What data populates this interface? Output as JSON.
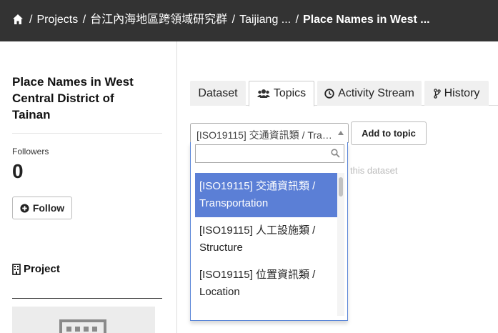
{
  "breadcrumb": {
    "home_icon": "home-icon",
    "items": [
      "Projects",
      "台江內海地區跨領域研究群",
      "Taijiang ..."
    ],
    "current": "Place Names in West ...",
    "separator": "/"
  },
  "sidebar": {
    "title": "Place Names in West Central District of Tainan",
    "followers_label": "Followers",
    "followers_count": "0",
    "follow_button": "Follow",
    "project_label": "Project"
  },
  "tabs": [
    {
      "label": "Dataset",
      "icon": ""
    },
    {
      "label": "Topics",
      "icon": "users-icon"
    },
    {
      "label": "Activity Stream",
      "icon": "clock-icon"
    },
    {
      "label": "History",
      "icon": "branch-icon"
    }
  ],
  "topic_select": {
    "value": "[ISO19115] 交通資訊類 / Transportation",
    "search_value": "",
    "options": [
      "[ISO19115] 交通資訊類 / Transportation",
      "[ISO19115] 人工設施類 / Structure",
      "[ISO19115] 位置資訊類 / Location"
    ]
  },
  "add_topic_button": "Add to topic",
  "hint_text": "this dataset",
  "colors": {
    "topbar": "#333333",
    "highlight": "#5b7fd6",
    "dropdown_border": "#5b86d8"
  }
}
